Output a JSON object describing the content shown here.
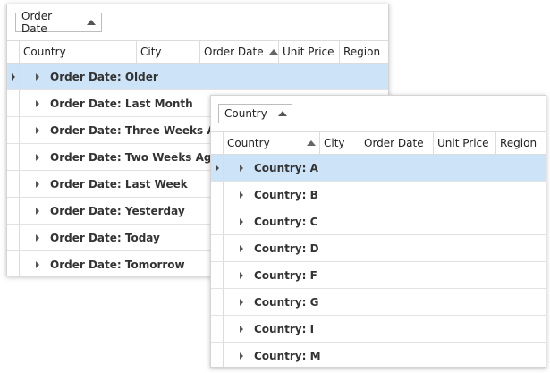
{
  "grid1": {
    "group_panel": {
      "chip_label": "Order Date"
    },
    "columns": [
      "Country",
      "City",
      "Order Date",
      "Unit Price",
      "Region"
    ],
    "rows": [
      "Order Date: Older",
      "Order Date: Last Month",
      "Order Date: Three Weeks Ago",
      "Order Date: Two Weeks Ago",
      "Order Date: Last Week",
      "Order Date: Yesterday",
      "Order Date: Today",
      "Order Date: Tomorrow"
    ]
  },
  "grid2": {
    "group_panel": {
      "chip_label": "Country"
    },
    "columns": [
      "Country",
      "City",
      "Order Date",
      "Unit Price",
      "Region"
    ],
    "rows": [
      "Country: A",
      "Country: B",
      "Country: C",
      "Country: D",
      "Country: F",
      "Country: G",
      "Country: I",
      "Country: M"
    ]
  },
  "colors": {
    "focused_row": "#cde3f7"
  }
}
